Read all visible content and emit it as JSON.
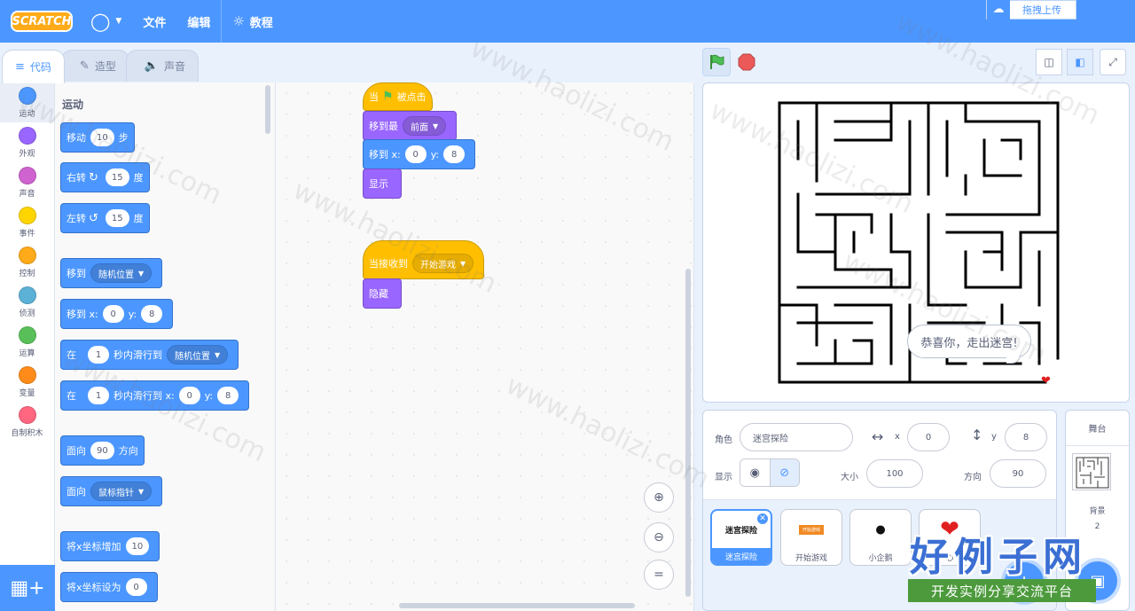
{
  "menu": {
    "logo": "SCRATCH",
    "file": "文件",
    "edit": "编辑",
    "tutorials": "教程",
    "upload": "拖拽上传"
  },
  "tabs": [
    {
      "label": "代码",
      "icon": "code-icon",
      "active": true
    },
    {
      "label": "造型",
      "icon": "brush-icon",
      "active": false
    },
    {
      "label": "声音",
      "icon": "speaker-icon",
      "active": false
    }
  ],
  "categories": [
    {
      "label": "运动",
      "color": "#4c97ff"
    },
    {
      "label": "外观",
      "color": "#9966ff"
    },
    {
      "label": "声音",
      "color": "#cf63cf"
    },
    {
      "label": "事件",
      "color": "#ffd500"
    },
    {
      "label": "控制",
      "color": "#ffab19"
    },
    {
      "label": "侦测",
      "color": "#5cb1d6"
    },
    {
      "label": "运算",
      "color": "#59c059"
    },
    {
      "label": "变量",
      "color": "#ff8c1a"
    },
    {
      "label": "自制积木",
      "color": "#ff6680"
    }
  ],
  "palette": {
    "title": "运动",
    "move": {
      "a": "移动",
      "v": "10",
      "b": "步"
    },
    "turn_right": {
      "a": "右转",
      "v": "15",
      "b": "度"
    },
    "turn_left": {
      "a": "左转",
      "v": "15",
      "b": "度"
    },
    "goto": {
      "a": "移到",
      "dd": "随机位置"
    },
    "goto_xy": {
      "a": "移到 x:",
      "x": "0",
      "yl": "y:",
      "y": "8"
    },
    "glide": {
      "a": "在",
      "v": "1",
      "b": "秒内滑行到",
      "dd": "随机位置"
    },
    "glide_xy": {
      "a": "在",
      "v": "1",
      "b": "秒内滑行到 x:",
      "x": "0",
      "yl": "y:",
      "y": "8"
    },
    "point_dir": {
      "a": "面向",
      "v": "90",
      "b": "方向"
    },
    "point_towards": {
      "a": "面向",
      "dd": "鼠标指针"
    },
    "change_x": {
      "a": "将x坐标增加",
      "v": "10"
    },
    "set_x": {
      "a": "将x坐标设为",
      "v": "0"
    }
  },
  "script1": {
    "hat_a": "当",
    "hat_b": "被点击",
    "front_a": "移到最",
    "front_dd": "前面",
    "goto_a": "移到 x:",
    "goto_x": "0",
    "goto_yl": "y:",
    "goto_y": "8",
    "show": "显示"
  },
  "script2": {
    "hat_a": "当接收到",
    "hat_dd": "开始游戏",
    "hide": "隐藏"
  },
  "stage": {
    "speech": "恭喜你，走出迷宫!"
  },
  "sprite_info": {
    "sprite_label": "角色",
    "sprite_name": "迷宫探险",
    "x_label": "x",
    "x": "0",
    "y_label": "y",
    "y": "8",
    "show_label": "显示",
    "size_label": "大小",
    "size": "100",
    "dir_label": "方向",
    "dir": "90"
  },
  "sprites": [
    {
      "name": "迷宫探险",
      "thumb": "迷宫探险",
      "selected": true
    },
    {
      "name": "开始游戏",
      "thumb": "开始游戏",
      "selected": false
    },
    {
      "name": "小企鹅",
      "thumb": "",
      "selected": false
    },
    {
      "name": "心",
      "thumb": "",
      "selected": false
    }
  ],
  "stage_panel": {
    "title": "舞台",
    "bg_label": "背景",
    "bg_count": "2"
  },
  "watermark": {
    "repeat": "www.haolizi.com",
    "brand": "好例子网",
    "slogan": "开发实例分享交流平台"
  }
}
